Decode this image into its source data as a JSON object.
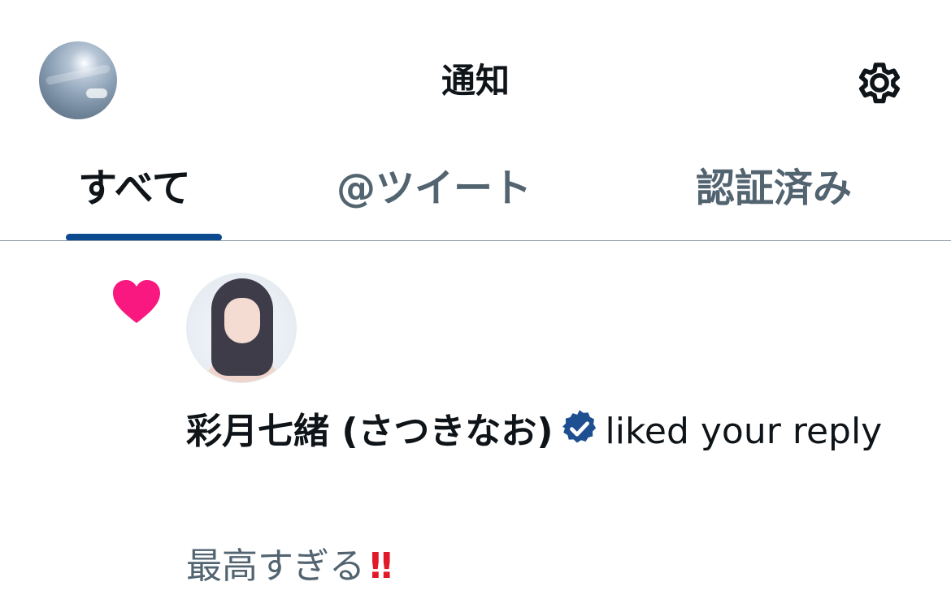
{
  "header": {
    "title": "通知",
    "avatar_icon": "profile-avatar",
    "settings_icon": "gear-icon"
  },
  "tabs": [
    {
      "label": "すべて",
      "active": true
    },
    {
      "label": "@ツイート",
      "active": false
    },
    {
      "label": "認証済み",
      "active": false
    }
  ],
  "notification": {
    "type_icon": "heart-icon",
    "type_color": "#f91880",
    "user_name": "彩月七緒 (さつきなお)",
    "verified_icon": "verified-badge-icon",
    "verified_color": "#1d4f91",
    "action_text": "liked your reply",
    "tweet_text": "最高すぎる",
    "tweet_emoji": "‼"
  },
  "colors": {
    "tab_indicator": "#0c4a8f",
    "primary_text": "#0f1419",
    "secondary_text": "#536471"
  }
}
